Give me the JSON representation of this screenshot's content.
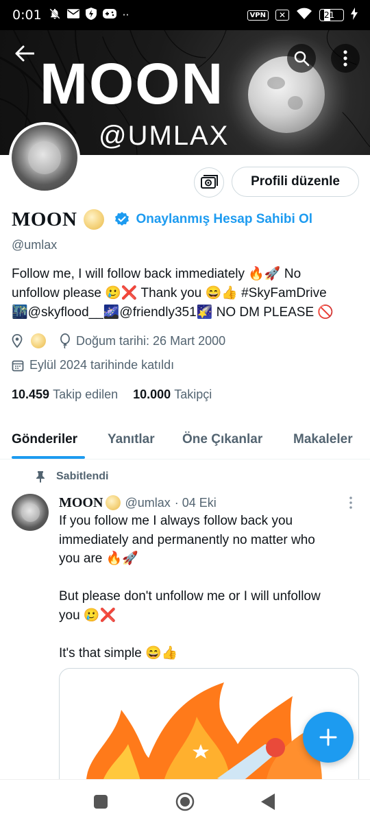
{
  "status_bar": {
    "time": "0:01",
    "more": "··",
    "vpn": "VPN",
    "battery": "21"
  },
  "banner": {
    "title": "MOON",
    "handle": "@UMLAX"
  },
  "profile": {
    "name": "MOON",
    "verify_link": "Onaylanmış Hesap Sahibi Ol",
    "handle": "@umlax",
    "bio_line1": "Follow me, I will follow back immediately 🔥🚀 No",
    "bio_line2": "unfollow please 🥲❌ Thank you 😄👍 #SkyFamDrive",
    "bio_line3": "🌃@skyflood__🌌@friendly351🌠 NO DM PLEASE 🚫",
    "birthday": "Doğum tarihi: 26 Mart 2000",
    "joined": "Eylül 2024 tarihinde katıldı",
    "following_count": "10.459",
    "following_label": "Takip edilen",
    "followers_count": "10.000",
    "followers_label": "Takipçi",
    "edit_button": "Profili düzenle"
  },
  "tabs": [
    {
      "label": "Gönderiler",
      "active": true
    },
    {
      "label": "Yanıtlar",
      "active": false
    },
    {
      "label": "Öne Çıkanlar",
      "active": false
    },
    {
      "label": "Makaleler",
      "active": false
    }
  ],
  "pinned_tweet": {
    "pinned_label": "Sabitlendi",
    "author": "MOON",
    "handle": "@umlax",
    "date": "· 04 Eki",
    "line1": "If you follow me I always follow back you",
    "line2": "immediately and permanently no matter who",
    "line3": "you are 🔥🚀",
    "line4": "But please don't unfollow me or I will unfollow",
    "line5": "you 🥲❌",
    "line6": "It's that simple 😄👍"
  },
  "colors": {
    "accent": "#1d9bf0",
    "text": "#0f1419",
    "secondary": "#536471"
  },
  "icons": [
    "back-arrow-icon",
    "search-icon",
    "more-vertical-icon",
    "camera-switch-icon",
    "verified-badge-icon",
    "location-icon",
    "balloon-icon",
    "calendar-icon",
    "pin-icon",
    "compose-plus-icon"
  ]
}
